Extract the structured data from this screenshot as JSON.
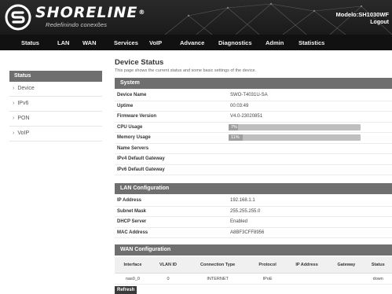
{
  "header": {
    "brand": "SHORELINE",
    "trademark": "®",
    "tagline": "Redefinindo conexões",
    "model": "Modelo:SH1030WF",
    "logout": "Logout"
  },
  "nav": [
    "Status",
    "LAN",
    "WAN",
    "Services",
    "VoIP",
    "Advance",
    "Diagnostics",
    "Admin",
    "Statistics"
  ],
  "sidebar": {
    "title": "Status",
    "items": [
      "Device",
      "IPv6",
      "PON",
      "VoIP"
    ]
  },
  "page": {
    "title": "Device Status",
    "description": "This page shows the current status and some basic settings of the device."
  },
  "system": {
    "header": "System",
    "device_name_label": "Device Name",
    "device_name": "SWO-T4031U-SA",
    "uptime_label": "Uptime",
    "uptime": "00:03:49",
    "firmware_label": "Firmware Version",
    "firmware": "V4.0-23020851",
    "cpu_label": "CPU Usage",
    "cpu_usage": "7%",
    "cpu_fraction": 0.07,
    "memory_label": "Memory Usage",
    "memory_usage": "11%",
    "memory_fraction": 0.11,
    "name_servers_label": "Name Servers",
    "ipv4_gw_label": "IPv4 Default Gateway",
    "ipv6_gw_label": "IPv6 Default Gateway"
  },
  "lan": {
    "header": "LAN Configuration",
    "ip_label": "IP Address",
    "ip": "192.168.1.1",
    "mask_label": "Subnet Mask",
    "mask": "255.255.255.0",
    "dhcp_label": "DHCP Server",
    "dhcp": "Enabled",
    "mac_label": "MAC Address",
    "mac": "A8BF3CFF8956"
  },
  "wan": {
    "header": "WAN Configuration",
    "columns": [
      "Interface",
      "VLAN ID",
      "Connection Type",
      "Protocol",
      "IP Address",
      "Gateway",
      "Status"
    ],
    "rows": [
      [
        "nas0_0",
        "0",
        "INTERNET",
        "IPoE",
        "",
        "",
        "down"
      ]
    ]
  },
  "refresh_label": "Refresh"
}
